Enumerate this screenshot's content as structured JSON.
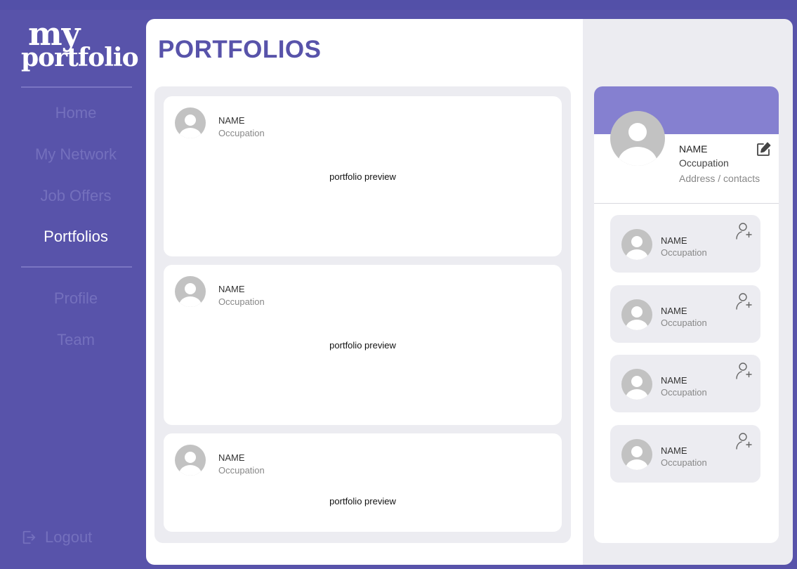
{
  "app": {
    "logo_line1": "my",
    "logo_line2": "portfolio"
  },
  "sidebar": {
    "items": [
      {
        "label": "Home"
      },
      {
        "label": "My Network"
      },
      {
        "label": "Job Offers"
      },
      {
        "label": "Portfolios",
        "active": true
      },
      {
        "label": "Profile"
      },
      {
        "label": "Team"
      }
    ],
    "logout_label": "Logout"
  },
  "main": {
    "title": "PORTFOLIOS",
    "cards": [
      {
        "name": "NAME",
        "occupation": "Occupation",
        "preview": "portfolio preview"
      },
      {
        "name": "NAME",
        "occupation": "Occupation",
        "preview": "portfolio preview"
      },
      {
        "name": "NAME",
        "occupation": "Occupation",
        "preview": "portfolio preview"
      }
    ]
  },
  "profile": {
    "name": "NAME",
    "occupation": "Occupation",
    "address": "Address / contacts",
    "edit_icon": "edit-icon"
  },
  "suggestions": [
    {
      "name": "NAME",
      "occupation": "Occupation",
      "icon": "add-user-icon"
    },
    {
      "name": "NAME",
      "occupation": "Occupation",
      "icon": "add-user-icon"
    },
    {
      "name": "NAME",
      "occupation": "Occupation",
      "icon": "add-user-icon"
    },
    {
      "name": "NAME",
      "occupation": "Occupation",
      "icon": "add-user-icon"
    }
  ],
  "colors": {
    "brand": "#5853aa",
    "banner": "#8580d0",
    "panel": "#ececf1",
    "nav_inactive": "#7470bd"
  }
}
